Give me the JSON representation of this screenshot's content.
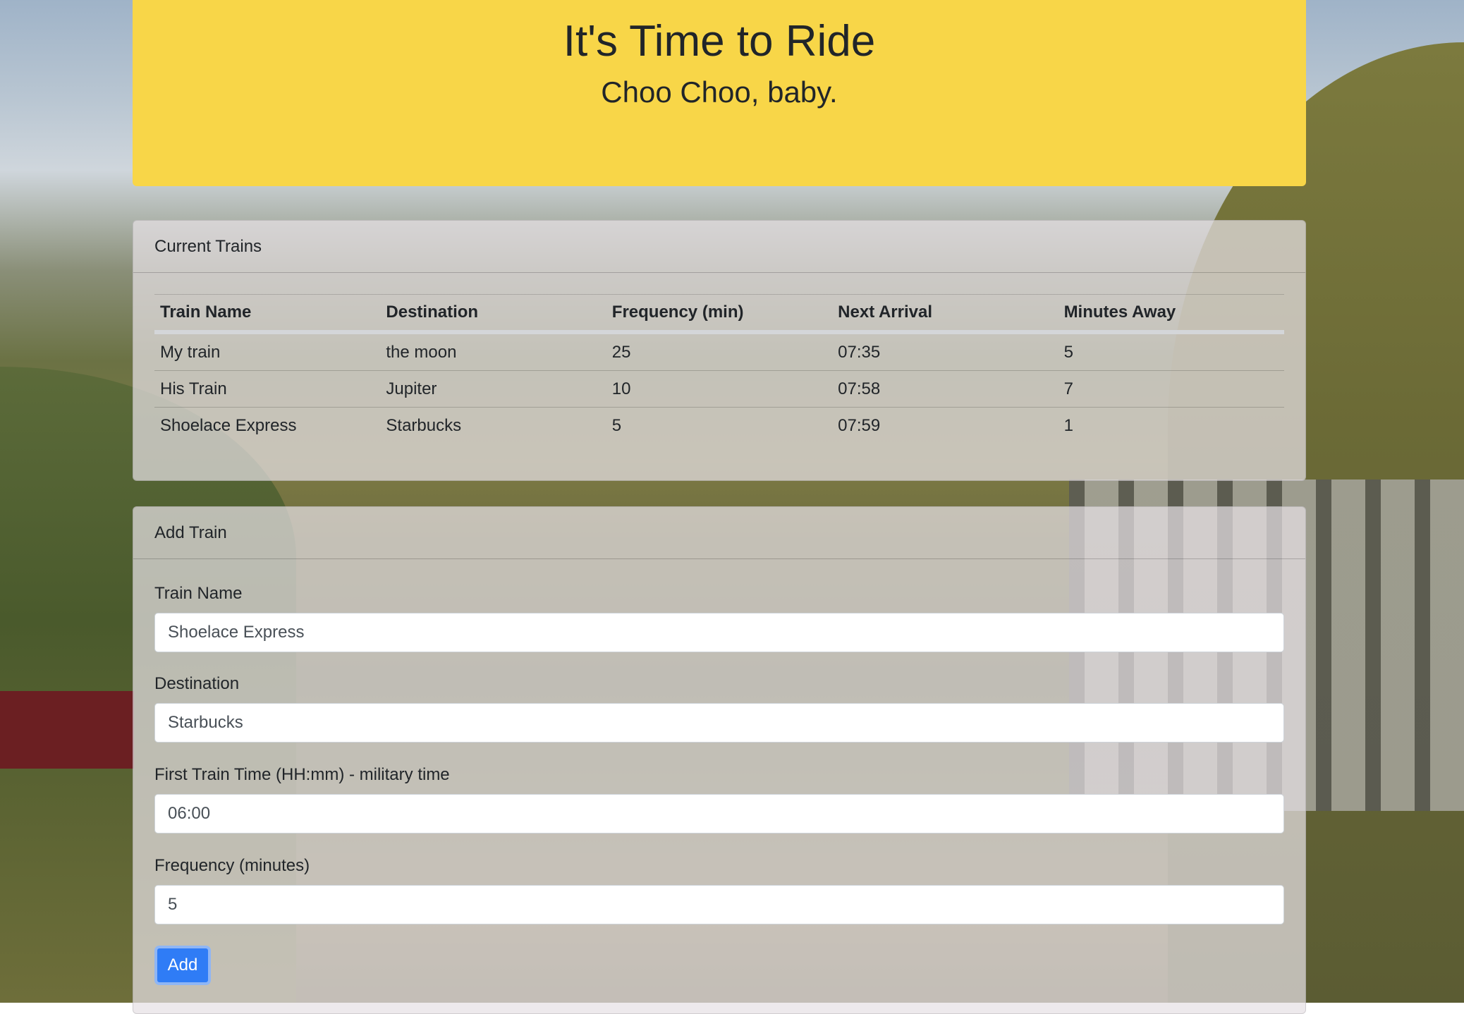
{
  "header": {
    "title": "It's Time to Ride",
    "subtitle": "Choo Choo, baby."
  },
  "current_trains": {
    "heading": "Current Trains",
    "columns": [
      "Train Name",
      "Destination",
      "Frequency (min)",
      "Next Arrival",
      "Minutes Away"
    ],
    "rows": [
      [
        "My train",
        "the moon",
        "25",
        "07:35",
        "5"
      ],
      [
        "His Train",
        "Jupiter",
        "10",
        "07:58",
        "7"
      ],
      [
        "Shoelace Express",
        "Starbucks",
        "5",
        "07:59",
        "1"
      ]
    ]
  },
  "add_train": {
    "heading": "Add Train",
    "train_name_label": "Train Name",
    "train_name_value": "Shoelace Express",
    "destination_label": "Destination",
    "destination_value": "Starbucks",
    "first_time_label": "First Train Time (HH:mm) - military time",
    "first_time_value": "06:00",
    "frequency_label": "Frequency (minutes)",
    "frequency_value": "5",
    "add_button": "Add"
  },
  "colors": {
    "jumbotron": "#f8d648",
    "button": "#2f7cf6"
  }
}
